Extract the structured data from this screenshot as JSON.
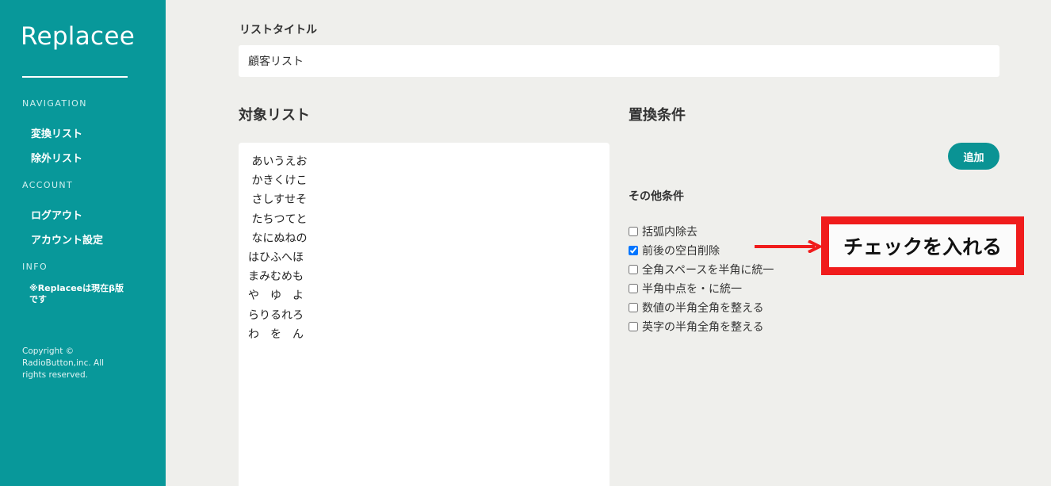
{
  "sidebar": {
    "brand": "Replacee",
    "sections": [
      {
        "title": "NAVIGATION",
        "items": [
          "変換リスト",
          "除外リスト"
        ]
      },
      {
        "title": "ACCOUNT",
        "items": [
          "ログアウト",
          "アカウント設定"
        ]
      },
      {
        "title": "INFO"
      }
    ],
    "note": "※Replaceeは現在β版です",
    "copyright": "Copyright © RadioButton,inc. All rights reserved."
  },
  "main": {
    "list_title_label": "リストタイトル",
    "list_title_value": "顧客リスト",
    "target_list_label": "対象リスト",
    "target_list_value": " あいうえお\n かきくけこ\n さしすせそ\n たちつてと\n なにぬねの\nはひふへほ\nまみむめも\nや　ゆ　よ\nらりるれろ\nわ　を　ん",
    "replace_conditions_label": "置換条件",
    "add_button": "追加",
    "other_conditions_label": "その他条件",
    "options": [
      {
        "label": "括弧内除去",
        "checked": false
      },
      {
        "label": "前後の空白削除",
        "checked": true
      },
      {
        "label": "全角スペースを半角に統一",
        "checked": false
      },
      {
        "label": "半角中点を・に統一",
        "checked": false
      },
      {
        "label": "数値の半角全角を整える",
        "checked": false
      },
      {
        "label": "英字の半角全角を整える",
        "checked": false
      }
    ]
  },
  "annotation": {
    "text": "チェックを入れる",
    "color": "#f01c1c"
  },
  "colors": {
    "sidebar": "#08989a",
    "button": "#0a9394",
    "background": "#efefec"
  }
}
